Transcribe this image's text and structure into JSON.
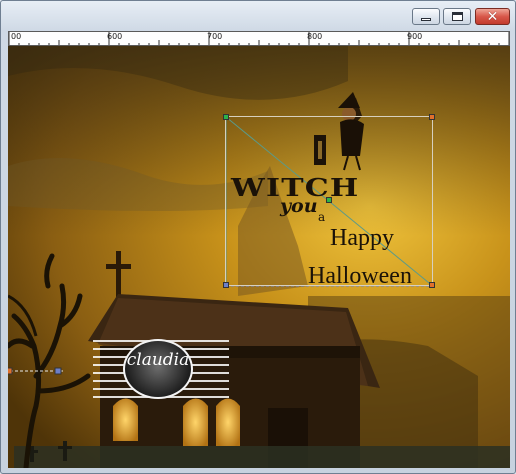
{
  "window": {
    "controls": {
      "minimize_icon": "minimize-icon",
      "maximize_icon": "maximize-icon",
      "close_icon": "close-icon"
    }
  },
  "ruler": {
    "labels": [
      "00",
      "600",
      "700",
      "800",
      "900"
    ]
  },
  "artwork": {
    "text_i": "I",
    "text_witch": "WITCH",
    "text_you": "you",
    "text_a": "a",
    "text_happy": "Happy",
    "text_halloween": "Halloween"
  },
  "watermark": {
    "text": "claudia"
  },
  "colors": {
    "sky_amber": "#c8921a",
    "dark_brown": "#2a1a08",
    "selection_green": "#2bb44a",
    "selection_orange": "#e0702c"
  }
}
